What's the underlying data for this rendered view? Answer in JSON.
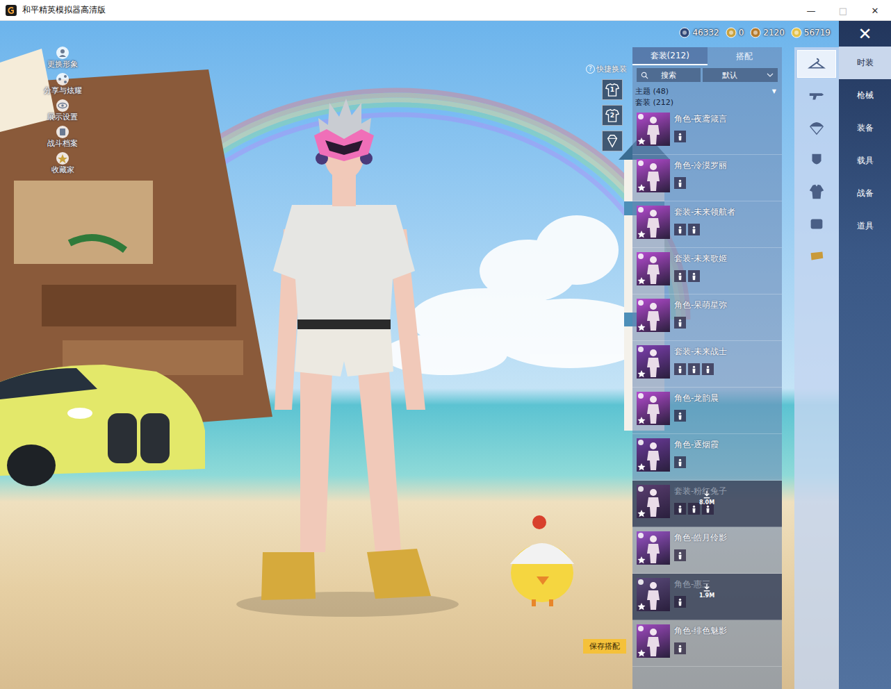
{
  "window": {
    "title": "和平精英模拟器高清版",
    "controls": [
      {
        "label": "—",
        "kind": "minimize"
      },
      {
        "label": "□",
        "kind": "maximize"
      },
      {
        "label": "✕",
        "kind": "close"
      }
    ]
  },
  "left_menu": [
    {
      "label": "更换形象",
      "kind": "avatar"
    },
    {
      "label": "分享与炫耀",
      "kind": "share"
    },
    {
      "label": "展示设置",
      "kind": "eye"
    },
    {
      "label": "战斗档案",
      "kind": "archive"
    },
    {
      "label": "收藏家",
      "kind": "collector"
    }
  ],
  "currencies": [
    {
      "amount": "46332",
      "color": "#2f4677"
    },
    {
      "amount": "0",
      "color": "#c9a13d"
    },
    {
      "amount": "2120",
      "color": "#b57a2c"
    },
    {
      "amount": "56719",
      "color": "#e3c24a"
    }
  ],
  "close": "✕",
  "quick_change": {
    "help": "?",
    "label": "快捷换装",
    "slots": [
      {
        "kind": "shirt",
        "number": "1"
      },
      {
        "kind": "shirt",
        "number": "2"
      },
      {
        "kind": "diamond",
        "number": ""
      }
    ]
  },
  "panel": {
    "tabs": [
      {
        "label": "套装(212)",
        "selected": true
      },
      {
        "label": "搭配",
        "selected": false
      }
    ],
    "search": {
      "placeholder": "搜索"
    },
    "sort": {
      "value": "默认"
    },
    "groups": [
      {
        "label": "主题 (48)",
        "arrow": "▼"
      },
      {
        "label": "套装 (212)",
        "arrow": ""
      }
    ],
    "items": [
      {
        "name": "角色-夜鸢箴言",
        "color": "#b54bd0",
        "parts": 1,
        "available": true,
        "size": ""
      },
      {
        "name": "角色-冷漠罗丽",
        "color": "#b54bd0",
        "parts": 1,
        "available": true,
        "size": ""
      },
      {
        "name": "套装-未来领航者",
        "color": "#b54bd0",
        "parts": 2,
        "available": true,
        "size": ""
      },
      {
        "name": "套装-未来歌姬",
        "color": "#b54bd0",
        "parts": 2,
        "available": true,
        "size": ""
      },
      {
        "name": "角色-呆萌星弥",
        "color": "#b54bd0",
        "parts": 1,
        "available": true,
        "size": ""
      },
      {
        "name": "套装-未来战士",
        "color": "#7e3fb0",
        "parts": 3,
        "available": true,
        "size": ""
      },
      {
        "name": "角色-龙韵晨",
        "color": "#b54bd0",
        "parts": 1,
        "available": true,
        "size": ""
      },
      {
        "name": "角色-逐烟霞",
        "color": "#6b3a9a",
        "parts": 1,
        "available": true,
        "size": ""
      },
      {
        "name": "套装-粉红兔子",
        "color": "#5a3e70",
        "parts": 3,
        "available": false,
        "size": "8.0M"
      },
      {
        "name": "角色-皓月伶影",
        "color": "#9a52c8",
        "parts": 1,
        "available": true,
        "size": ""
      },
      {
        "name": "角色-惠三",
        "color": "#5a4a7a",
        "parts": 1,
        "available": false,
        "size": "1.9M"
      },
      {
        "name": "角色-绯色魅影",
        "color": "#a04ac0",
        "parts": 1,
        "available": true,
        "size": ""
      }
    ],
    "save_button": "保存搭配"
  },
  "icon_tabs": [
    {
      "kind": "hanger",
      "selected": true
    },
    {
      "kind": "gun",
      "selected": false
    },
    {
      "kind": "parachute",
      "selected": false
    },
    {
      "kind": "mask",
      "selected": false
    },
    {
      "kind": "jacket",
      "selected": false
    },
    {
      "kind": "backpack",
      "selected": false
    },
    {
      "kind": "crate",
      "selected": false
    }
  ],
  "categories": [
    {
      "label": "时装",
      "selected": true
    },
    {
      "label": "枪械",
      "selected": false
    },
    {
      "label": "装备",
      "selected": false
    },
    {
      "label": "载具",
      "selected": false
    },
    {
      "label": "战备",
      "selected": false
    },
    {
      "label": "道具",
      "selected": false
    }
  ]
}
